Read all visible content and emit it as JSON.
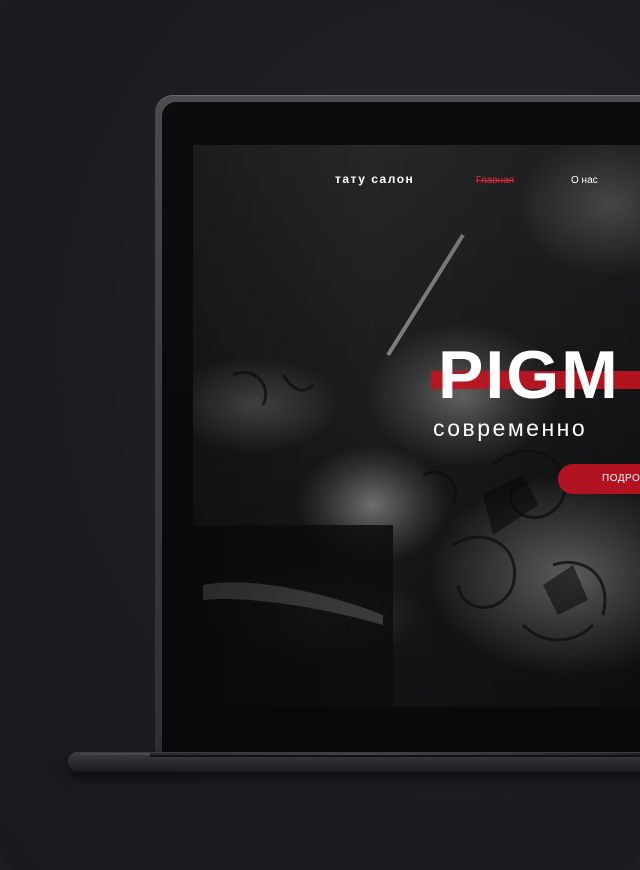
{
  "nav": {
    "brand": "тату салон",
    "links": [
      {
        "label": "Главная",
        "active": true
      },
      {
        "label": "О нас",
        "active": false
      }
    ]
  },
  "hero": {
    "title": "PIGM",
    "subtitle": "современно",
    "button_label": "ПОДРО"
  },
  "colors": {
    "accent_red": "#c0131f",
    "active_link": "#e02a36",
    "background": "#1c1d22"
  }
}
